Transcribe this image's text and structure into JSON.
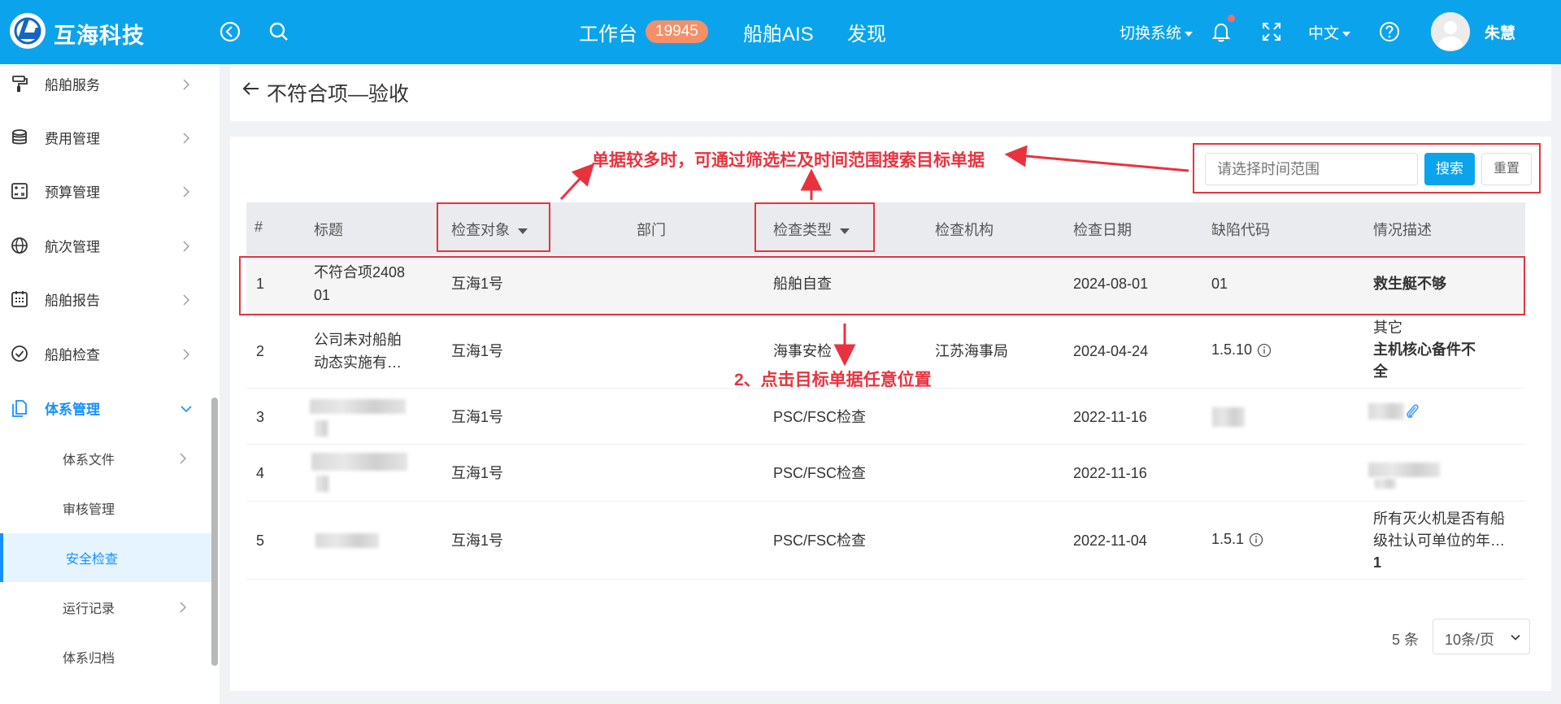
{
  "header": {
    "brand": "互海科技",
    "nav": [
      {
        "label": "工作台",
        "badge": "19945"
      },
      {
        "label": "船舶AIS"
      },
      {
        "label": "发现"
      }
    ],
    "switch_system": "切换系统",
    "language": "中文",
    "user_name": "朱慧"
  },
  "sidebar": {
    "items": [
      {
        "label": "船舶服务",
        "icon": "paint-roller-icon"
      },
      {
        "label": "费用管理",
        "icon": "database-icon"
      },
      {
        "label": "预算管理",
        "icon": "calculator-icon"
      },
      {
        "label": "航次管理",
        "icon": "globe-icon"
      },
      {
        "label": "船舶报告",
        "icon": "calendar-icon"
      },
      {
        "label": "船舶检查",
        "icon": "check-circle-icon"
      },
      {
        "label": "体系管理",
        "icon": "documents-icon"
      }
    ],
    "sub_items": [
      {
        "label": "体系文件"
      },
      {
        "label": "审核管理"
      },
      {
        "label": "安全检查"
      },
      {
        "label": "运行记录"
      },
      {
        "label": "体系归档"
      }
    ],
    "accent_color": "#1890ff"
  },
  "page": {
    "title": "不符合项—验收"
  },
  "filter": {
    "date_placeholder": "请选择时间范围",
    "search_label": "搜索",
    "reset_label": "重置"
  },
  "table": {
    "columns": [
      "#",
      "标题",
      "检查对象",
      "部门",
      "检查类型",
      "检查机构",
      "检查日期",
      "缺陷代码",
      "情况描述"
    ],
    "rows": [
      {
        "no": "1",
        "title": "不符合项2408",
        "title2": "01",
        "target": "互海1号",
        "type": "船舶自查",
        "org": "",
        "date": "2024-08-01",
        "code": "01",
        "desc": "救生艇不够"
      },
      {
        "no": "2",
        "title": "公司未对船舶",
        "title2": "动态实施有…",
        "target": "互海1号",
        "type": "海事安检",
        "org": "江苏海事局",
        "date": "2024-04-24",
        "code": "1.5.10",
        "desc_line1": "其它",
        "desc_line2": "主机核心备件不",
        "desc_line3": "全"
      },
      {
        "no": "3",
        "target": "互海1号",
        "type": "PSC/FSC检查",
        "date": "2022-11-16"
      },
      {
        "no": "4",
        "target": "互海1号",
        "type": "PSC/FSC检查",
        "date": "2022-11-16"
      },
      {
        "no": "5",
        "target": "互海1号",
        "type": "PSC/FSC检查",
        "date": "2022-11-04",
        "code": "1.5.1",
        "desc_line1": "所有灭火机是否有船",
        "desc_line2": "级社认可单位的年…",
        "desc_line3": "1"
      }
    ]
  },
  "pager": {
    "total": "5 条",
    "page_size": "10条/页"
  },
  "annotations": {
    "tip1": "单据较多时，可通过筛选栏及时间范围搜索目标单据",
    "tip2": "2、点击目标单据任意位置",
    "color": "#e8333f"
  }
}
